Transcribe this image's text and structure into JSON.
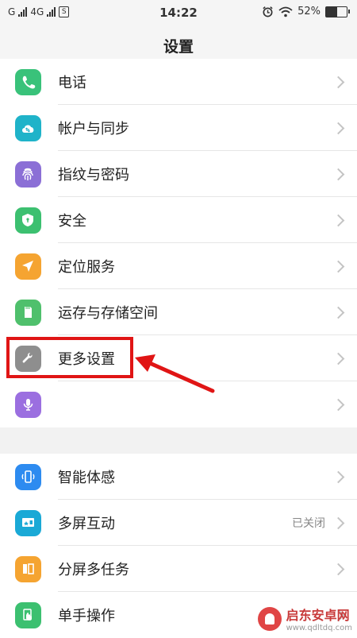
{
  "status_bar": {
    "carrier_left": "G",
    "network": "4G",
    "sim_label": "S",
    "time": "14:22",
    "battery": "52%",
    "battery_level": 0.52
  },
  "header": {
    "title": "设置"
  },
  "group1": [
    {
      "label": "电话",
      "icon": "phone-icon",
      "color": "#39c27a"
    },
    {
      "label": "帐户与同步",
      "icon": "cloud-sync-icon",
      "color": "#1fb3c9"
    },
    {
      "label": "指纹与密码",
      "icon": "fingerprint-icon",
      "color": "#8b6fd6"
    },
    {
      "label": "安全",
      "icon": "shield-icon",
      "color": "#3cc070"
    },
    {
      "label": "定位服务",
      "icon": "location-arrow-icon",
      "color": "#f5a431"
    },
    {
      "label": "运存与存储空间",
      "icon": "sd-card-icon",
      "color": "#4fc06c"
    },
    {
      "label": "更多设置",
      "icon": "wrench-icon",
      "color": "#8e8e8e"
    },
    {
      "label": "",
      "icon": "microphone-icon",
      "color": "#9b6fe0"
    }
  ],
  "group2": [
    {
      "label": "智能体感",
      "icon": "phone-motion-icon",
      "color": "#2d8bf0"
    },
    {
      "label": "多屏互动",
      "icon": "screen-cast-icon",
      "color": "#1aa9d6",
      "value": "已关闭"
    },
    {
      "label": "分屏多任务",
      "icon": "split-screen-icon",
      "color": "#f5a431"
    },
    {
      "label": "单手操作",
      "icon": "one-hand-icon",
      "color": "#3cc070"
    }
  ],
  "watermark": {
    "name": "启东安卓网",
    "url": "www.qdltdq.com"
  }
}
